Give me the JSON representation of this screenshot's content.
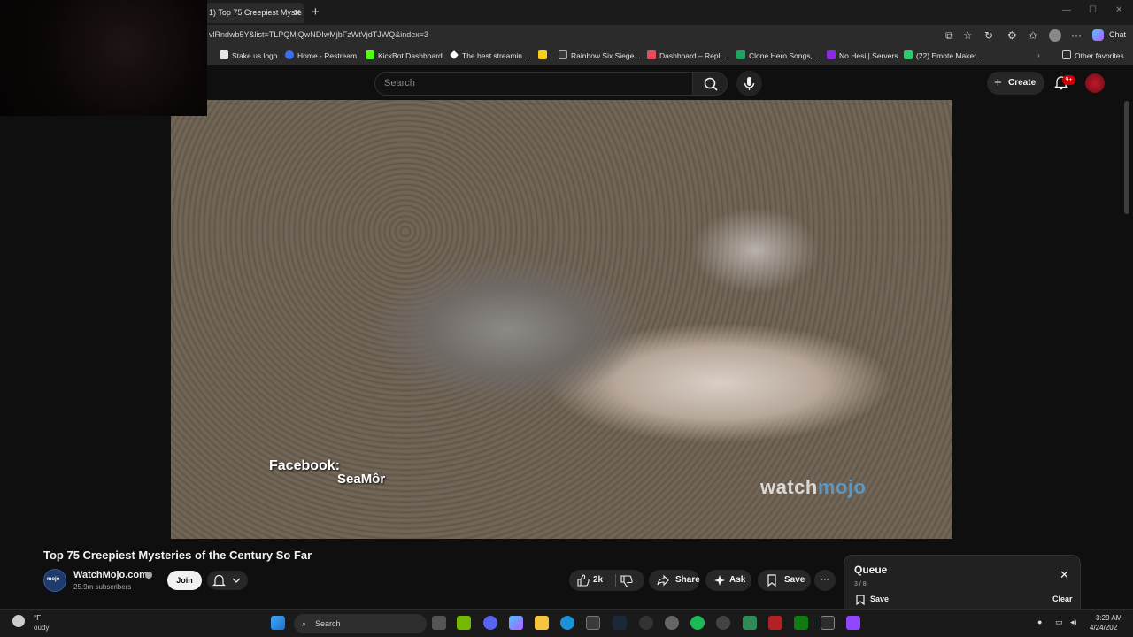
{
  "browser": {
    "active_tab_title": "1) Top 75 Creepiest Myste",
    "url": "vlRndwb5Y&list=TLPQMjQwNDIwMjbFzWtVjdTJWQ&index=3",
    "chat_label": "Chat"
  },
  "bookmarks": [
    {
      "label": "Stake.us logo",
      "color": "#e6e6e6"
    },
    {
      "label": "Home - Restream",
      "color": "#3b6df5"
    },
    {
      "label": "KickBot Dashboard",
      "color": "#53fc18"
    },
    {
      "label": "The best streamin...",
      "color": "#ffffff"
    },
    {
      "label": "",
      "color": "#f7d117"
    },
    {
      "label": "Rainbow Six Siege...",
      "color": "#cfcfcf"
    },
    {
      "label": "Dashboard – Repli...",
      "color": "#e84a5f"
    },
    {
      "label": "Clone Hero Songs,...",
      "color": "#1fa463"
    },
    {
      "label": "No Hesi | Servers",
      "color": "#8a2be2"
    },
    {
      "label": "(22) Emote Maker...",
      "color": "#2ecc71"
    }
  ],
  "other_favorites": "Other favorites",
  "youtube": {
    "search_placeholder": "Search",
    "create_label": "Create",
    "notif_badge": "9+"
  },
  "video": {
    "title": "Top 75 Creepiest Mysteries of the Century So Far",
    "overlay_label": "Facebook:",
    "overlay_name": "SeaMôr",
    "watermark_a": "watch",
    "watermark_b": "mojo",
    "channel_avatar_text": "mojo",
    "channel_name": "WatchMojo.com",
    "subscribers": "25.9m subscribers",
    "join_label": "Join",
    "like_count": "2k",
    "share_label": "Share",
    "ask_label": "Ask",
    "save_label": "Save",
    "more_label": "···"
  },
  "queue": {
    "title": "Queue",
    "count": "3 / 8",
    "save_label": "Save",
    "clear_label": "Clear"
  },
  "taskbar": {
    "weather_temp": "°F",
    "weather_desc": "oudy",
    "search_label": "Search",
    "time": "3:29 AM",
    "date": "4/24/202"
  }
}
